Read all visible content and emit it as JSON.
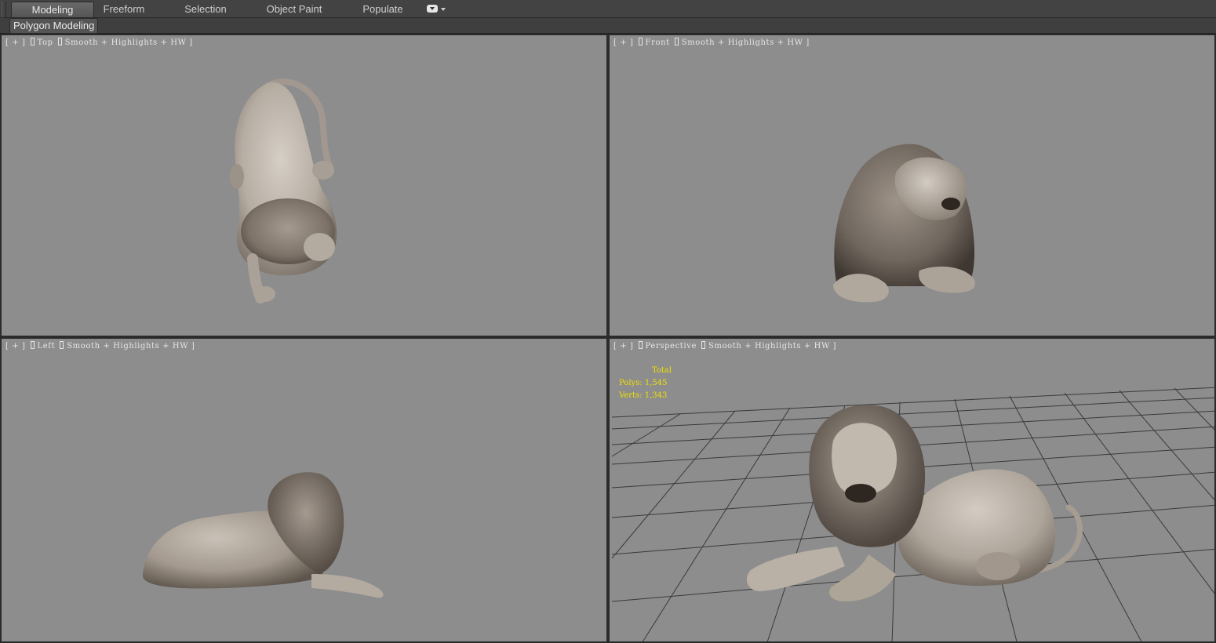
{
  "ribbon": {
    "tabs": [
      {
        "label": "Modeling",
        "active": true
      },
      {
        "label": "Freeform",
        "active": false
      },
      {
        "label": "Selection",
        "active": false
      },
      {
        "label": "Object Paint",
        "active": false
      },
      {
        "label": "Populate",
        "active": false
      }
    ],
    "panel_label": "Polygon Modeling"
  },
  "viewports": {
    "top": {
      "label": [
        "[ + ]",
        "Top",
        "Smooth + Highlights + HW ]"
      ]
    },
    "front": {
      "label": [
        "[ + ]",
        "Front",
        "Smooth + Highlights + HW ]"
      ]
    },
    "left": {
      "label": [
        "[ + ]",
        "Left",
        "Smooth + Highlights + HW ]"
      ]
    },
    "perspective": {
      "label": [
        "[ + ]",
        "Perspective",
        "Smooth + Highlights + HW ]"
      ]
    }
  },
  "statistics": {
    "heading": "Total",
    "polys": "Polys: 1,545",
    "verts": "Verts: 1,343"
  },
  "colors": {
    "viewport_bg": "#8d8d8d",
    "stats_text": "#f0e000",
    "label_text": "#e6e6e6",
    "grid_line": "#3a3a3a"
  }
}
